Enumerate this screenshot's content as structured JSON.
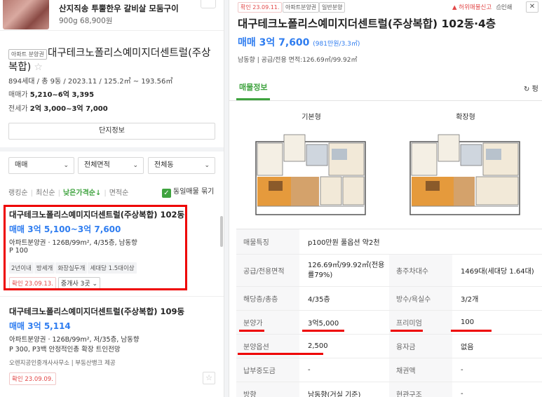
{
  "colors": {
    "accent_green": "#3fa33f",
    "price_blue": "#2f7df0",
    "confirm_red": "#e24848",
    "highlight_red": "#ee0000"
  },
  "ad": {
    "title": "산지직송 투뿔한우 갈비살 모둠구이",
    "sub": "900g 68,900원"
  },
  "complex": {
    "tag": "아파트 분양권",
    "name": "대구테크노폴리스예미지더센트럴(주상복합)",
    "star": "☆",
    "info": "894세대 / 총 9동 / 2023.11 / 125.2㎡ ~ 193.56㎡",
    "sale_label": "매매가",
    "sale_value": "5,210~6억 3,395",
    "jeonse_label": "전세가",
    "jeonse_value": "2억 3,000~3억 7,000",
    "danji_button": "단지정보"
  },
  "filters": {
    "type": "매매",
    "area": "전체면적",
    "dong": "전체동"
  },
  "sort": {
    "items": [
      "랭킹순",
      "최신순",
      "낮은가격순↓",
      "면적순"
    ],
    "same_listing": "동일매물 묶기"
  },
  "listings": [
    {
      "title": "대구테크노폴리스예미지더센트럴(주상복합) 102동",
      "price": "매매 3억 5,100~3억 7,600",
      "spec": "아파트분양권 · 126B/99m², 4/35층, 남동향",
      "note": "P 100",
      "tags": [
        "2년이내",
        "방세개",
        "화장실두개",
        "세대당 1.5대이상"
      ],
      "confirm": "확인 23.09.13.",
      "agent": "중개사 3곳"
    },
    {
      "title": "대구테크노폴리스예미지더센트럴(주상복합) 109동",
      "price": "매매 3억 5,114",
      "spec": "아파트분양권 · 126B/99m², 저/35층, 남동향",
      "note": "P 300, P3백 안정적인총 확장 트인전망",
      "agent_line": "오렌지공인중개사사무소 | 부동산뱅크 제공",
      "confirm": "확인 23.09.09."
    }
  ],
  "detail": {
    "confirm": "확인 23.09.11.",
    "badges": [
      "아파트분양권",
      "일반분양"
    ],
    "report": "허위매물신고",
    "print": "인쇄",
    "title": "대구테크노폴리스예미지더센트럴(주상복합) 102동·4층",
    "price": "매매 3억 7,600",
    "price_per": "(981만원/3.3㎡)",
    "info": "남동향 | 공급/전용 면적:126.69㎡/99.92㎡",
    "tab": "매물정보",
    "refresh": "펑",
    "plans": [
      "기본형",
      "확장형"
    ],
    "table": [
      {
        "label": "매물특징",
        "value": "p100만원 풀옵션 약2천"
      },
      {
        "label": "공급/전용면적",
        "value": "126.69㎡/99.92㎡(전용률79%)",
        "label2": "총주차대수",
        "value2": "1469대(세대당 1.64대)"
      },
      {
        "label": "해당층/총층",
        "value": "4/35층",
        "label2": "방수/욕실수",
        "value2": "3/2개"
      },
      {
        "label": "분양가",
        "value": "3억5,000",
        "label2": "프리미엄",
        "value2": "100"
      },
      {
        "label": "분양옵션",
        "value": "2,500",
        "label2": "융자금",
        "value2": "없음"
      },
      {
        "label": "납부중도금",
        "value": "-",
        "label2": "채권액",
        "value2": "-"
      },
      {
        "label": "방향",
        "value": "남동향(거실 기준)",
        "label2": "현관구조",
        "value2": "-"
      }
    ]
  }
}
